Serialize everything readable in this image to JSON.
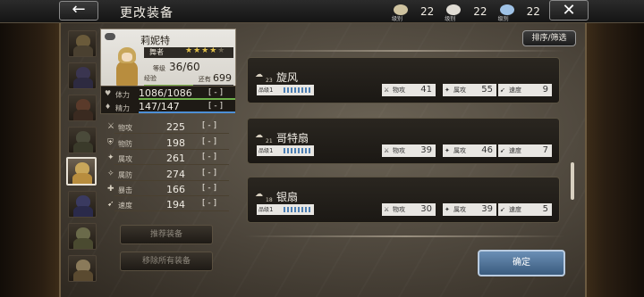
{
  "header": {
    "back_icon": "←",
    "title": "更改装备",
    "close_icon": "✕",
    "materials": [
      {
        "label": "级别",
        "value": "22",
        "color": "#cfc3a0"
      },
      {
        "label": "级别",
        "value": "22",
        "color": "#e0dcd4"
      },
      {
        "label": "级别",
        "value": "22",
        "color": "#9fc2e6"
      }
    ]
  },
  "character": {
    "name": "莉妮特",
    "job": "舞者",
    "stars_filled": "★★★★",
    "stars_empty": "★",
    "level_label": "等级",
    "level_value": "36/60",
    "exp_label": "经验",
    "exp_remaining_label": "还有",
    "exp_remaining_value": "699",
    "exp_fill_fraction": 0.55,
    "hp": {
      "label": "体力",
      "value": "1086/1086",
      "box": "[ - ]",
      "fill_fraction": 1.0
    },
    "mp": {
      "label": "精力",
      "value": "147/147",
      "box": "[ - ]",
      "fill_fraction": 1.0
    }
  },
  "stats": [
    {
      "icon": "⚔",
      "label": "物攻",
      "value": "225",
      "box": "[ - ]"
    },
    {
      "icon": "⛨",
      "label": "物防",
      "value": "198",
      "box": "[ - ]"
    },
    {
      "icon": "✦",
      "label": "属攻",
      "value": "261",
      "box": "[ - ]"
    },
    {
      "icon": "✧",
      "label": "属防",
      "value": "274",
      "box": "[ - ]"
    },
    {
      "icon": "✚",
      "label": "暴击",
      "value": "166",
      "box": "[ - ]"
    },
    {
      "icon": "➹",
      "label": "速度",
      "value": "194",
      "box": "[ - ]"
    }
  ],
  "buttons": {
    "recommend": "推荐装备",
    "remove_all": "移除所有装备",
    "sort_filter": "排序/筛选",
    "confirm": "确定"
  },
  "equipment": [
    {
      "level": "23",
      "name": "旋风",
      "rank_label": "品级",
      "rank_value": "1",
      "stats": [
        {
          "icon": "⚔",
          "label": "物攻",
          "value": "41"
        },
        {
          "icon": "✦",
          "label": "属攻",
          "value": "55"
        },
        {
          "icon": "➹",
          "label": "速度",
          "value": "9"
        }
      ]
    },
    {
      "level": "21",
      "name": "哥特扇",
      "rank_label": "品级",
      "rank_value": "1",
      "stats": [
        {
          "icon": "⚔",
          "label": "物攻",
          "value": "39"
        },
        {
          "icon": "✦",
          "label": "属攻",
          "value": "46"
        },
        {
          "icon": "➹",
          "label": "速度",
          "value": "7"
        }
      ]
    },
    {
      "level": "18",
      "name": "银扇",
      "rank_label": "品级",
      "rank_value": "1",
      "stats": [
        {
          "icon": "⚔",
          "label": "物攻",
          "value": "30"
        },
        {
          "icon": "✦",
          "label": "属攻",
          "value": "39"
        },
        {
          "icon": "➹",
          "label": "速度",
          "value": "5"
        }
      ]
    }
  ],
  "portraits": [
    {
      "hair": "#6a5a3a",
      "body": "#4a4030"
    },
    {
      "hair": "#3a3550",
      "body": "#2d2a40"
    },
    {
      "hair": "#5a3a2a",
      "body": "#3a2a20"
    },
    {
      "hair": "#4a4a3a",
      "body": "#3a3a2a"
    },
    {
      "hair": "#c8a65a",
      "body": "#b88d3e"
    },
    {
      "hair": "#3a3a60",
      "body": "#2a2a4a"
    },
    {
      "hair": "#6a6a4a",
      "body": "#4a4a30"
    },
    {
      "hair": "#8a7a5a",
      "body": "#5a4a30"
    }
  ]
}
